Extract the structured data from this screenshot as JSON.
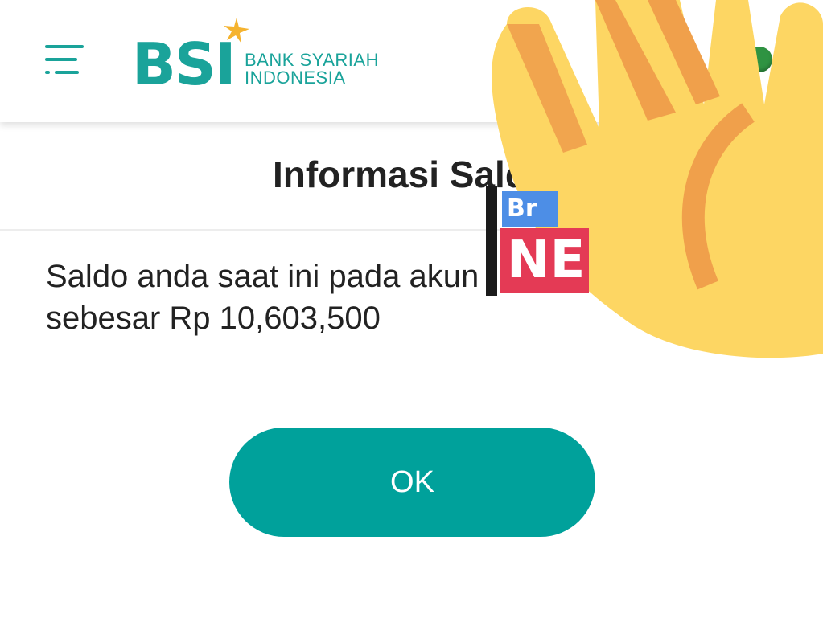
{
  "header": {
    "brand_mark": "BSI",
    "brand_name_line1": "BANK SYARIAH",
    "brand_name_line2": "INDONESIA",
    "colors": {
      "brand": "#1aa39a",
      "star": "#f5b32f",
      "status": "#2f9342"
    },
    "menu_icon": "hamburger-menu-icon",
    "status_icon": "online-status-dot"
  },
  "page": {
    "title": "Informasi Saldo",
    "message_line1": "Saldo anda saat ini pada akun",
    "message_line2": "sebesar Rp 10,603,500"
  },
  "actions": {
    "ok_label": "OK",
    "ok_color": "#00a19b"
  },
  "overlay": {
    "emoji": "raised-hand-emoji",
    "sticker_text_top": "Br",
    "sticker_text_bottom": "NE"
  }
}
